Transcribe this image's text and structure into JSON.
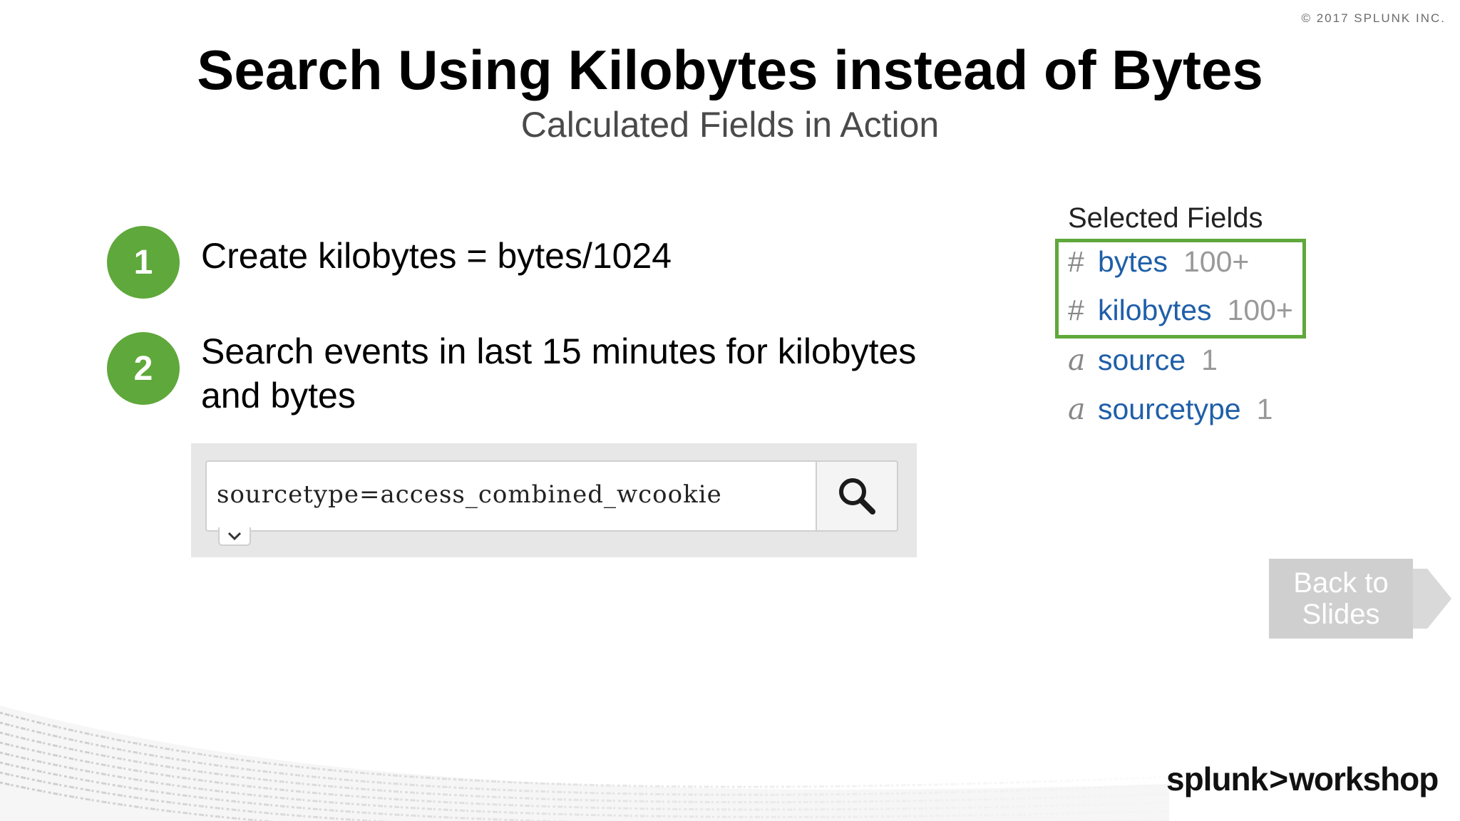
{
  "copyright": "© 2017 SPLUNK INC.",
  "title": "Search Using Kilobytes instead of Bytes",
  "subtitle": "Calculated Fields in Action",
  "steps": [
    {
      "number": "1",
      "text": "Create kilobytes = bytes/1024"
    },
    {
      "number": "2",
      "text": "Search events in last 15 minutes for kilobytes and bytes"
    }
  ],
  "search": {
    "query": "sourcetype=access_combined_wcookie"
  },
  "selected_fields": {
    "title": "Selected Fields",
    "items": [
      {
        "type": "#",
        "name": "bytes",
        "count": "100+"
      },
      {
        "type": "#",
        "name": "kilobytes",
        "count": "100+"
      },
      {
        "type": "a",
        "name": "source",
        "count": "1"
      },
      {
        "type": "a",
        "name": "sourcetype",
        "count": "1"
      }
    ]
  },
  "back_button": {
    "label": "Back to Slides"
  },
  "logo": {
    "left": "splunk",
    "separator": ">",
    "right": "workshop"
  },
  "colors": {
    "step_badge": "#5fa83b",
    "highlight_border": "#5fa83b",
    "field_name": "#1f5fa8",
    "back_button": "#cfcfcf"
  }
}
